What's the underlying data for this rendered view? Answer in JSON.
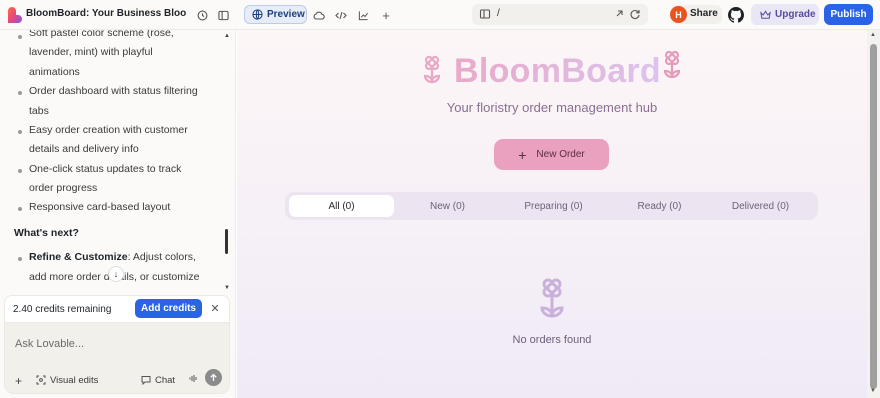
{
  "app": {
    "project_title": "BloomBoard: Your Business Bloom Tr"
  },
  "toolbar": {
    "preview_label": "Preview",
    "url_path": "/",
    "share_label": "Share",
    "avatar_initial": "H",
    "upgrade_label": "Upgrade",
    "publish_label": "Publish"
  },
  "chat": {
    "features": [
      "Soft pastel color scheme (rose,",
      "lavender, mint) with playful",
      "animations",
      "Order dashboard with status filtering",
      "tabs",
      "Easy order creation with customer",
      "details and delivery info",
      "One-click status updates to track",
      "order progress",
      "Responsive card-based layout"
    ],
    "next_heading": "What's next?",
    "next_item_bold": "Refine & Customize",
    "next_item_rest": ": Adjust colors,",
    "next_line2": "add more order details, or customize",
    "credits_text": "2.40 credits remaining",
    "add_credits_label": "Add credits",
    "ask_placeholder": "Ask Lovable...",
    "visual_edits_label": "Visual edits",
    "chat_label": "Chat"
  },
  "preview": {
    "brand": "BloomBoard",
    "tagline": "Your floristry order management hub",
    "new_order_label": "New Order",
    "tabs": [
      "All (0)",
      "New (0)",
      "Preparing (0)",
      "Ready (0)",
      "Delivered (0)"
    ],
    "empty_text": "No orders found"
  },
  "colors": {
    "accent_blue": "#2b63e6",
    "brand_pink": "#eaa9c8",
    "brand_lavender": "#dcc3ee",
    "button_pink": "#e9a1bf"
  }
}
